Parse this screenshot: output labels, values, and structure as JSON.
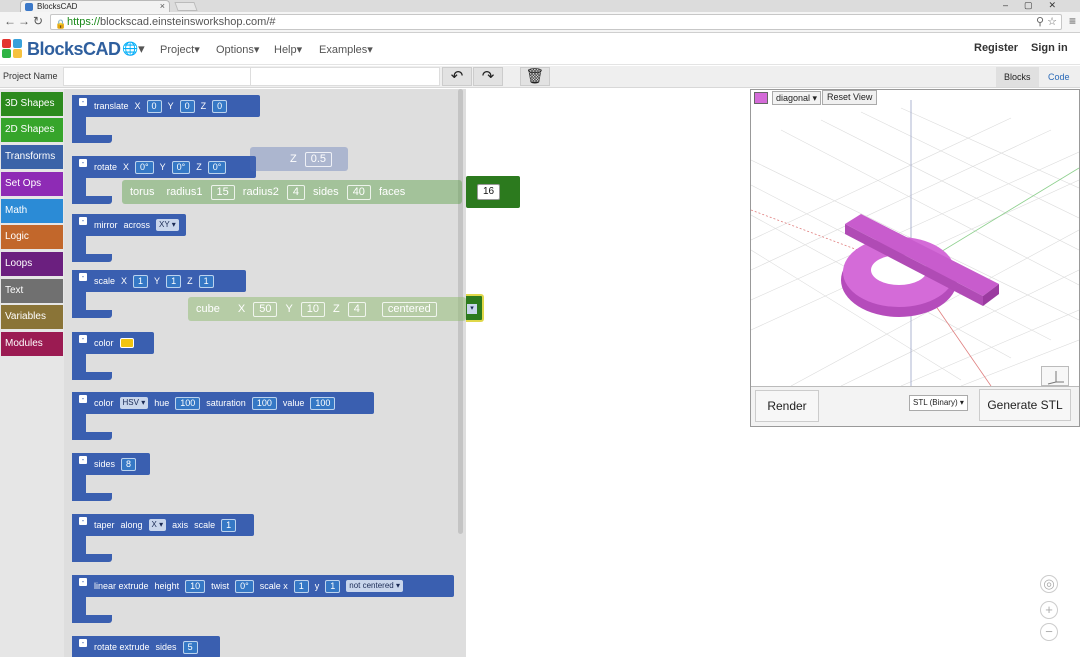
{
  "browser": {
    "tab_title": "BlocksCAD",
    "url_https": "https://",
    "url_rest": "blockscad.einsteinsworkshop.com/#"
  },
  "nav": {
    "logo_text": "BlocksCAD",
    "menus": [
      "Project",
      "Options",
      "Help",
      "Examples"
    ],
    "register": "Register",
    "signin": "Sign in"
  },
  "projectbar": {
    "label": "Project Name",
    "tabs": {
      "blocks": "Blocks",
      "code": "Code"
    }
  },
  "categories": [
    {
      "label": "3D Shapes",
      "color": "#2c8a1e"
    },
    {
      "label": "2D Shapes",
      "color": "#36a52b"
    },
    {
      "label": "Transforms",
      "color": "#3b63a8"
    },
    {
      "label": "Set Ops",
      "color": "#8e2bb5"
    },
    {
      "label": "Math",
      "color": "#2b8bd6"
    },
    {
      "label": "Logic",
      "color": "#c2672b"
    },
    {
      "label": "Loops",
      "color": "#6b1f7f"
    },
    {
      "label": "Text",
      "color": "#707070"
    },
    {
      "label": "Variables",
      "color": "#8a7437"
    },
    {
      "label": "Modules",
      "color": "#9b1b52"
    }
  ],
  "blocks": {
    "translate": {
      "name": "translate",
      "x": "X",
      "y": "Y",
      "z": "Z",
      "xv": "0",
      "yv": "0",
      "zv": "0"
    },
    "rotate": {
      "name": "rotate",
      "x": "X",
      "y": "Y",
      "z": "Z",
      "xv": "0°",
      "yv": "0°",
      "zv": "0°"
    },
    "mirror": {
      "name": "mirror",
      "across": "across",
      "plane": "XY"
    },
    "scale": {
      "name": "scale",
      "x": "X",
      "y": "Y",
      "z": "Z",
      "xv": "1",
      "yv": "1",
      "zv": "1"
    },
    "color": {
      "name": "color"
    },
    "colorhsv": {
      "name": "color",
      "mode": "HSV",
      "hue": "hue",
      "hv": "100",
      "sat": "saturation",
      "sv": "100",
      "val": "value",
      "vv": "100"
    },
    "sides": {
      "name": "sides",
      "v": "8"
    },
    "taper": {
      "name": "taper",
      "along": "along",
      "axis_v": "X",
      "axis": "axis",
      "scale": "scale",
      "v": "1"
    },
    "linear": {
      "name": "linear extrude",
      "height": "height",
      "hv": "10",
      "twist": "twist",
      "tv": "0°",
      "scalex": "scale x",
      "xv": "1",
      "y": "y",
      "yv": "1",
      "center": "not centered"
    },
    "rotateext": {
      "name": "rotate extrude",
      "sides": "sides",
      "v": "5"
    }
  },
  "ghosts": {
    "rotate_z": "Z",
    "rotate_zv": "0.5",
    "torus": {
      "name": "torus",
      "r1": "radius1",
      "r1v": "15",
      "r2": "radius2",
      "r2v": "4",
      "sides": "sides",
      "sv": "40",
      "faces": "faces",
      "fv": "16"
    },
    "cube": {
      "name": "cube",
      "x": "X",
      "xv": "50",
      "y": "Y",
      "yv": "10",
      "z": "Z",
      "zv": "4",
      "center": "centered"
    }
  },
  "viewer": {
    "view": "diagonal",
    "reset": "Reset View",
    "render": "Render",
    "format": "STL (Binary)",
    "generate": "Generate STL",
    "model_color": "#d46bd8"
  }
}
